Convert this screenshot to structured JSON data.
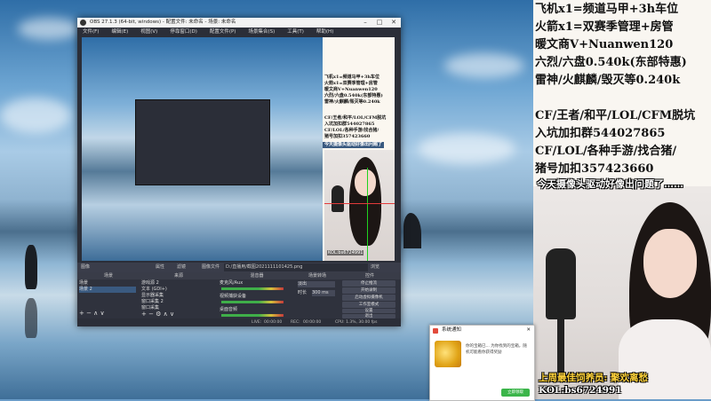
{
  "obs": {
    "title": "OBS 27.1.3 (64-bit, windows) - 配置文件: 未命名 - 场景: 未命名",
    "menu": [
      "文件(F)",
      "编辑(E)",
      "视图(V)",
      "停靠窗口(D)",
      "配置文件(P)",
      "场景集合(S)",
      "工具(T)",
      "帮助(H)"
    ],
    "preview_panel_lines": [
      "飞机x1=频道马甲+3h车位",
      "火箭x1=双赛季管理+房管",
      "暖文商V+Nuanwen120",
      "六烈/六盘0.540k(东部特惠)",
      "雷神/火麒麟/毁灭等0.240k",
      "CF/王者/和平/LOL/CFM脱坑",
      "入坑加扣群544027865",
      "CF/LOL/各种手游/找合猪/",
      "猪号加扣357423660",
      "今天摄像头驱动好像出问题了"
    ],
    "preview_cam_caption": "KOL:bs6724991",
    "toolbar": {
      "source_label": "图像",
      "properties": "属性",
      "filters": "滤镜",
      "image_file_label": "图像文件",
      "image_path": "D:/直播用/截图2021111101425.png",
      "browse": "浏览"
    },
    "docks": {
      "scenes_title": "场景",
      "sources_title": "来源",
      "mixer_title": "混音器",
      "transitions_title": "场景转场",
      "controls_title": "控件",
      "scenes": [
        "场景",
        "场景 2"
      ],
      "sources": [
        "游戏源 2",
        "文本 (GDI+)",
        "显示器采集",
        "窗口采集 2",
        "窗口采集"
      ],
      "mixer": [
        "麦克风/Aux",
        "视频捕获设备",
        "桌面音频"
      ],
      "transition_type": "淡出",
      "duration_label": "时长",
      "duration_value": "300 ms",
      "controls": [
        "停止推流",
        "开始录制",
        "启动虚拟摄像机",
        "工作室模式",
        "设置",
        "退出"
      ]
    },
    "status": {
      "live_label": "LIVE:",
      "live_time": "00:00:00",
      "rec_label": "REC:",
      "rec_time": "00:00:00",
      "cpu": "CPU: 1.3%, 30.00 fps"
    }
  },
  "right_panel": {
    "lines": [
      "飞机x1=频道马甲+3h车位",
      "火箭x1=双赛季管理+房管",
      "暖文商V+Nuanwen120",
      "六烈/六盘0.540k(东部特惠)",
      "雷神/火麒麟/毁灭等0.240k",
      "",
      "CF/王者/和平/LOL/CFM脱坑",
      "入坑加扣群544027865",
      "CF/LOL/各种手游/找合猪/",
      "猪号加扣357423660"
    ],
    "banner": "今天摄像头驱动好像出问题了……"
  },
  "webcam": {
    "caption_top": "上周最佳饲养员: 聚欢离愁",
    "caption_bottom": "KOL:bs6724991"
  },
  "popup": {
    "title": "系统通知",
    "message": "你的宝箱已... 为你找到的宝箱，随机可能看你获得奖励",
    "button": "立即领取"
  },
  "colors": {
    "obs_bg": "#2b2e38",
    "accent_green": "#3bb54a",
    "caption_yellow": "#ffd33a"
  }
}
